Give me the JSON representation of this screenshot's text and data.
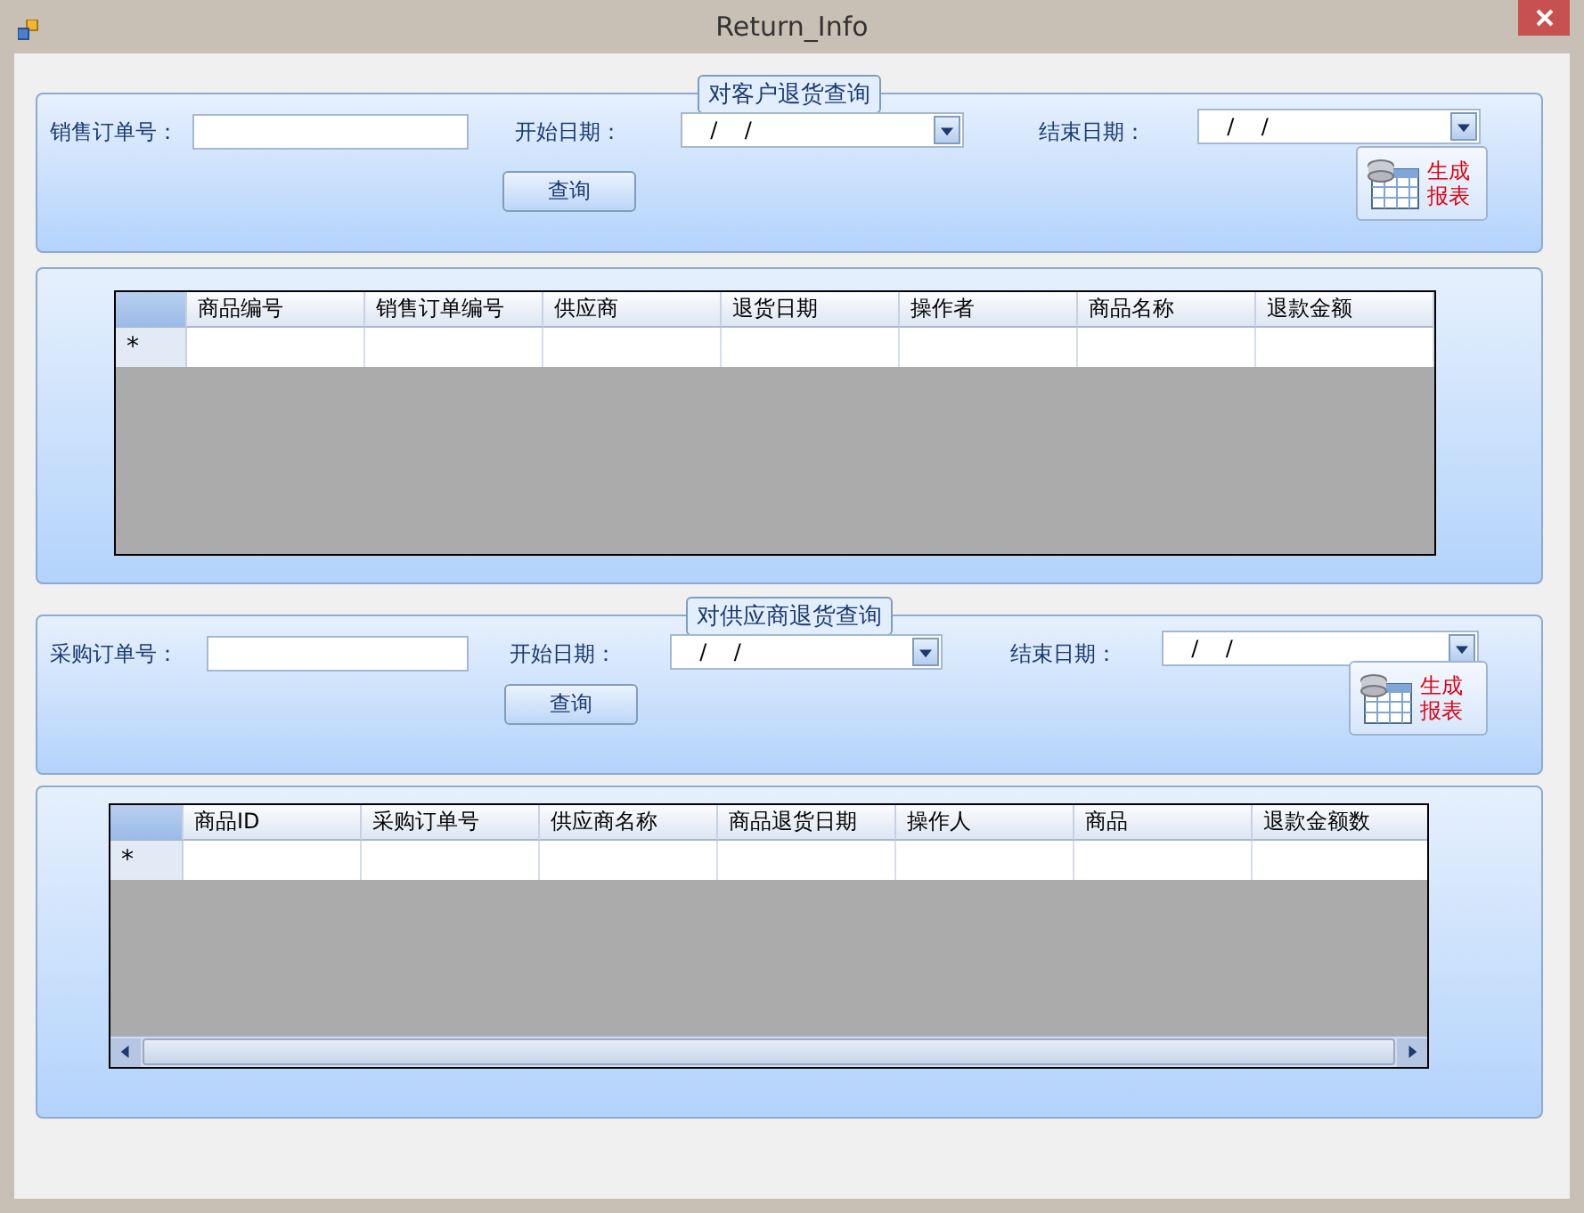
{
  "window": {
    "title": "Return_Info"
  },
  "sections": [
    {
      "legend": "对客户退货查询",
      "order_label": "销售订单号：",
      "start_label": "开始日期：",
      "start_value": "  /    /",
      "end_label": "结束日期：",
      "end_value": "  /    /",
      "query_button": "查询",
      "report_button": "生成报表",
      "grid": {
        "columns": [
          "商品编号",
          "销售订单编号",
          "供应商",
          "退货日期",
          "操作者",
          "商品名称",
          "退款金额"
        ],
        "new_row_marker": "*",
        "horizontal_scrollbar": false
      }
    },
    {
      "legend": "对供应商退货查询",
      "order_label": "采购订单号：",
      "start_label": "开始日期：",
      "start_value": "  /    /",
      "end_label": "结束日期：",
      "end_value": "  /    /",
      "query_button": "查询",
      "report_button": "生成报表",
      "grid": {
        "columns": [
          "商品ID",
          "采购订单号",
          "供应商名称",
          "商品退货日期",
          "操作人",
          "商品",
          "退款金额数"
        ],
        "new_row_marker": "*",
        "horizontal_scrollbar": true
      }
    }
  ]
}
